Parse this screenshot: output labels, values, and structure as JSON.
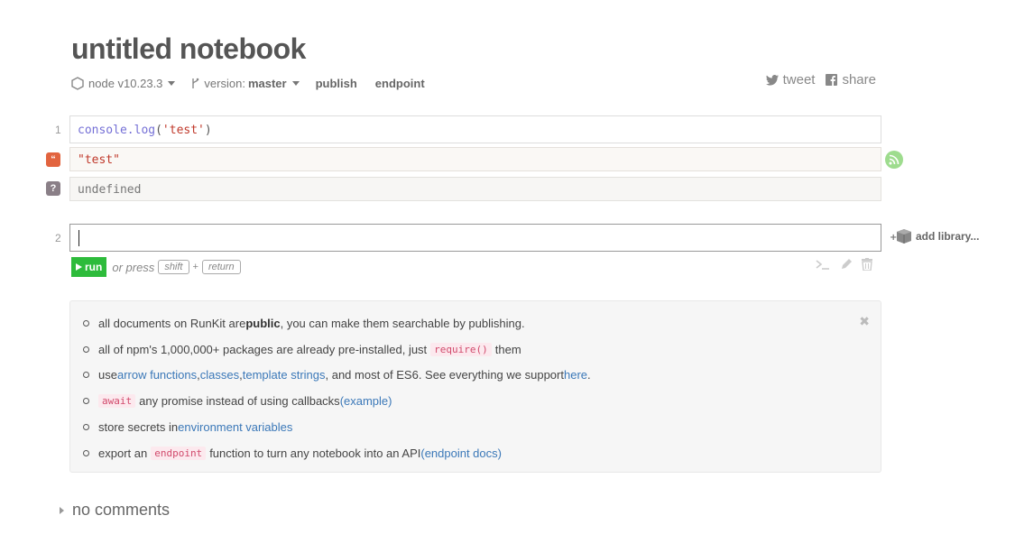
{
  "notebook": {
    "title": "untitled notebook",
    "node_version": "node v10.23.3",
    "version_label": "version:",
    "version_value": "master",
    "publish_label": "publish",
    "endpoint_label": "endpoint",
    "tweet_label": "tweet",
    "share_label": "share"
  },
  "cells": [
    {
      "line_number": "1",
      "code_fn": "console.log",
      "code_open": "(",
      "code_arg": "'test'",
      "code_close": ")",
      "output_string": "\"test\"",
      "output_return": "undefined",
      "badge_quote": "“",
      "badge_question": "?"
    },
    {
      "line_number": "2"
    }
  ],
  "editor": {
    "add_library_label": "add library...",
    "run_label": "run",
    "or_press": "or press",
    "key_shift": "shift",
    "plus": "+",
    "key_return": "return"
  },
  "tips": {
    "items": [
      {
        "pre": "all documents on RunKit are ",
        "bold": "public",
        "post": ", you can make them searchable by publishing."
      },
      {
        "pre": "all of npm's 1,000,000+ packages are already pre-installed, just ",
        "code": "require()",
        "post": " them"
      },
      {
        "pre": "use ",
        "link1": "arrow functions",
        "sep1": ", ",
        "link2": "classes",
        "sep2": ", ",
        "link3": "template strings",
        "mid": ", and most of ES6. See everything we support ",
        "link4": "here",
        "post": "."
      },
      {
        "code": "await",
        "pre": " any promise instead of using callbacks ",
        "link": "(example)"
      },
      {
        "pre": "store secrets in ",
        "link": "environment variables"
      },
      {
        "pre": "export an ",
        "code": "endpoint",
        "mid": " function to turn any notebook into an API ",
        "link": "(endpoint docs)"
      }
    ],
    "close_glyph": "✖"
  },
  "comments": {
    "label": "no comments"
  },
  "colors": {
    "run_button": "#2dbb3b",
    "link": "#3b78b8",
    "string_output": "#c0392b",
    "quote_badge": "#e2643f"
  }
}
